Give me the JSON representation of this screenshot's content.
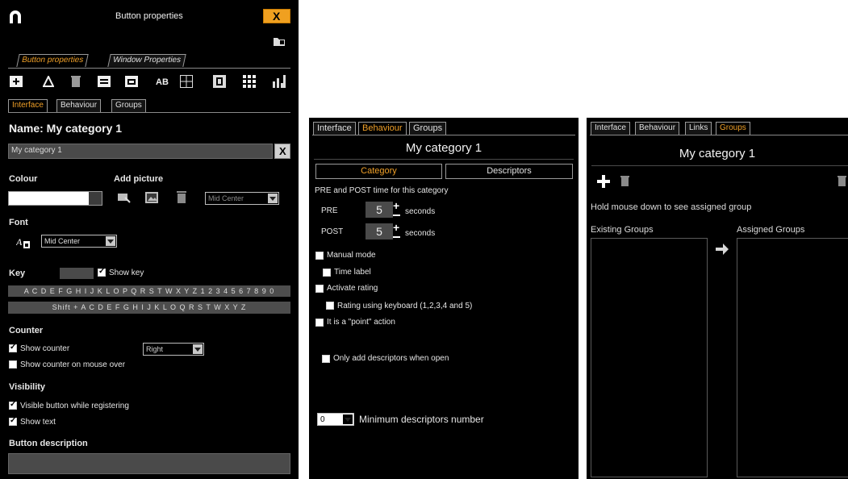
{
  "panel1": {
    "window_title": "Button properties",
    "close_label": "X",
    "top_tabs": [
      "Button properties",
      "Window Properties"
    ],
    "sub_tabs": [
      "Interface",
      "Behaviour",
      "Groups"
    ],
    "toolbar_icons": [
      "add-button-icon",
      "triangle-icon",
      "trash-icon",
      "card-icon",
      "window-icon",
      "ab-icon",
      "grid-4-icon",
      "film-icon",
      "grid-9-icon",
      "bar-chart-icon"
    ],
    "toolbar_ab_label": "AB",
    "name_heading": "Name: My category 1",
    "name_value": "My category 1",
    "clear_label": "X",
    "colour_label": "Colour",
    "add_picture_label": "Add picture",
    "picture_position": "Mid Center",
    "font_label": "Font",
    "font_position": "Mid Center",
    "key_label": "Key",
    "show_key_label": "Show key",
    "keys_row1": "A C D E F G H I J K L O P Q R S T W X Y Z 1 2 3 4 5 6 7 8 9 0",
    "keys_row2": "Shift + A C D E F G H I J K L O Q R S T W X Y Z",
    "counter_label": "Counter",
    "show_counter_label": "Show counter",
    "counter_position": "Right",
    "show_counter_hover_label": "Show counter on mouse over",
    "visibility_label": "Visibility",
    "visible_while_registering_label": "Visible button while registering",
    "show_text_label": "Show text",
    "button_description_label": "Button description",
    "colors": {
      "accent": "#f0a028",
      "close_bg": "#f0a020"
    }
  },
  "panel2": {
    "tabs": [
      "Interface",
      "Behaviour",
      "Groups"
    ],
    "title": "My category 1",
    "toggle_category": "Category",
    "toggle_descriptors": "Descriptors",
    "pre_post_caption": "PRE and POST time for this category",
    "pre_label": "PRE",
    "pre_value": "5",
    "post_label": "POST",
    "post_value": "5",
    "seconds_label": "seconds",
    "manual_mode_label": "Manual mode",
    "time_label_label": "Time label",
    "activate_rating_label": "Activate rating",
    "rating_keyboard_label": "Rating using keyboard (1,2,3,4 and 5)",
    "point_action_label": "It is a \"point\" action",
    "only_add_descriptors_label": "Only add descriptors when open",
    "min_descriptors_value": "0",
    "min_descriptors_label": "Minimum descriptors number"
  },
  "panel3": {
    "tabs": [
      "Interface",
      "Behaviour",
      "Links",
      "Groups"
    ],
    "title": "My category 1",
    "hint": "Hold mouse down to see assigned group",
    "existing_groups_label": "Existing Groups",
    "assigned_groups_label": "Assigned Groups"
  }
}
